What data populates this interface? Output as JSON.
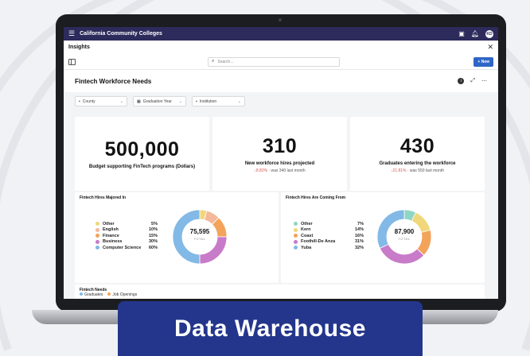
{
  "banner": {
    "text": "Data Warehouse"
  },
  "app": {
    "title": "California Community Colleges",
    "avatar": "KD"
  },
  "panel": {
    "title": "Insights"
  },
  "toolbar": {
    "search_placeholder": "Search...",
    "new_label": "+ New"
  },
  "dashboard": {
    "title": "Fintech Workforce Needs"
  },
  "filters": [
    {
      "label": "County",
      "icon": "map-pin-icon"
    },
    {
      "label": "Graduation Year",
      "icon": "calendar-icon"
    },
    {
      "label": "Institution",
      "icon": "building-icon"
    }
  ],
  "kpis": [
    {
      "value": "500,000",
      "label": "Budget supporting FinTech programs (Dollars)",
      "delta": "",
      "was": ""
    },
    {
      "value": "310",
      "label": "New workforce hires projected",
      "delta": "↓8.82%",
      "was": " · was 340 last month"
    },
    {
      "value": "430",
      "label": "Graduates entering the workforce",
      "delta": "↓21.81%",
      "was": " · was 550 last month"
    }
  ],
  "majored": {
    "title": "Fintech Hires Majored In",
    "total": "75,595",
    "total_label": "TOTAL",
    "items": [
      {
        "label": "Other",
        "pct": "5%",
        "value": 5,
        "color": "#f0d77a"
      },
      {
        "label": "English",
        "pct": "10%",
        "value": 10,
        "color": "#f4b89a"
      },
      {
        "label": "Finance",
        "pct": "15%",
        "value": 15,
        "color": "#f3a35a"
      },
      {
        "label": "Business",
        "pct": "30%",
        "value": 30,
        "color": "#c87bc9"
      },
      {
        "label": "Computer Science",
        "pct": "60%",
        "value": 60,
        "color": "#82b9e6"
      }
    ]
  },
  "coming": {
    "title": "Fintech Hires Are Coming From",
    "total": "87,900",
    "total_label": "TOTAL",
    "items": [
      {
        "label": "Other",
        "pct": "7%",
        "value": 7,
        "color": "#8fd6c4"
      },
      {
        "label": "Kern",
        "pct": "14%",
        "value": 14,
        "color": "#f0d77a"
      },
      {
        "label": "Coast",
        "pct": "16%",
        "value": 16,
        "color": "#f3a35a"
      },
      {
        "label": "Foothill-De Anza",
        "pct": "31%",
        "value": 31,
        "color": "#c87bc9"
      },
      {
        "label": "Yuba",
        "pct": "32%",
        "value": 32,
        "color": "#82b9e6"
      }
    ]
  },
  "needs": {
    "title": "Fintech Needs",
    "legend": [
      {
        "label": "Graduates",
        "color": "#82b9e6"
      },
      {
        "label": "Job Openings",
        "color": "#f3a35a"
      }
    ]
  }
}
